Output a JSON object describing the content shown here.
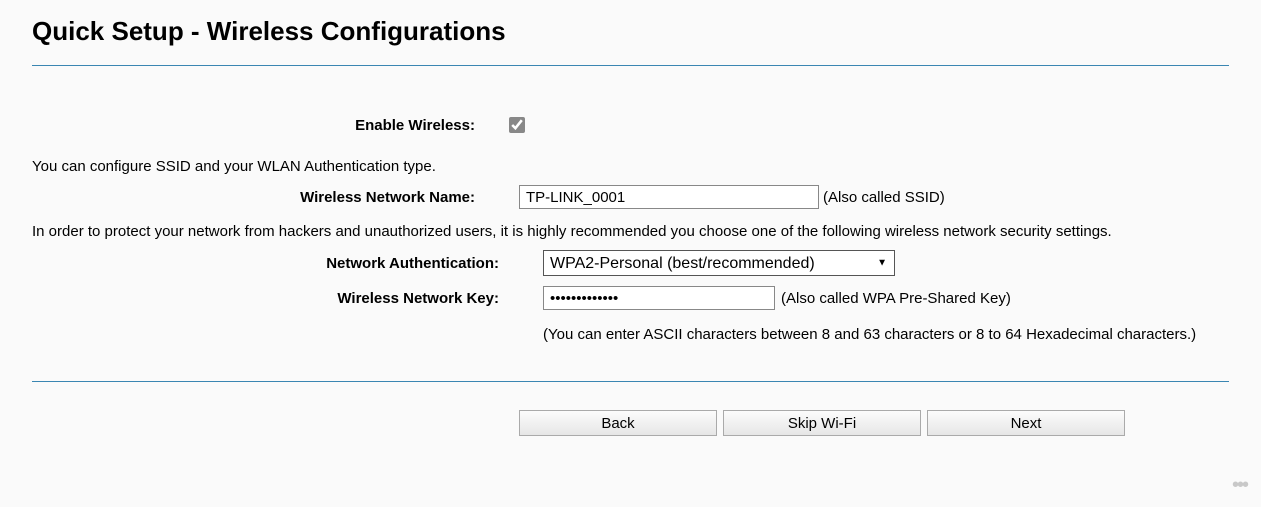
{
  "header": {
    "title": "Quick Setup - Wireless Configurations"
  },
  "form": {
    "enable_label": "Enable Wireless:",
    "enable_checked": "checked",
    "info1": "You can configure SSID and your WLAN Authentication type.",
    "ssid_label": "Wireless Network Name:",
    "ssid_value": "TP-LINK_0001",
    "ssid_hint": "(Also called SSID)",
    "info2": "In order to protect your network from hackers and unauthorized users, it is highly recommended you choose one of the following wireless network security settings.",
    "auth_label": "Network Authentication:",
    "auth_selected": "WPA2-Personal (best/recommended)",
    "key_label": "Wireless Network Key:",
    "key_value": "•••••••••••••",
    "key_hint": "(Also called WPA Pre-Shared Key)",
    "key_subhint": "(You can enter ASCII characters between 8 and 63 characters or 8 to 64 Hexadecimal characters.)"
  },
  "buttons": {
    "back": "Back",
    "skip": "Skip Wi-Fi",
    "next": "Next"
  }
}
